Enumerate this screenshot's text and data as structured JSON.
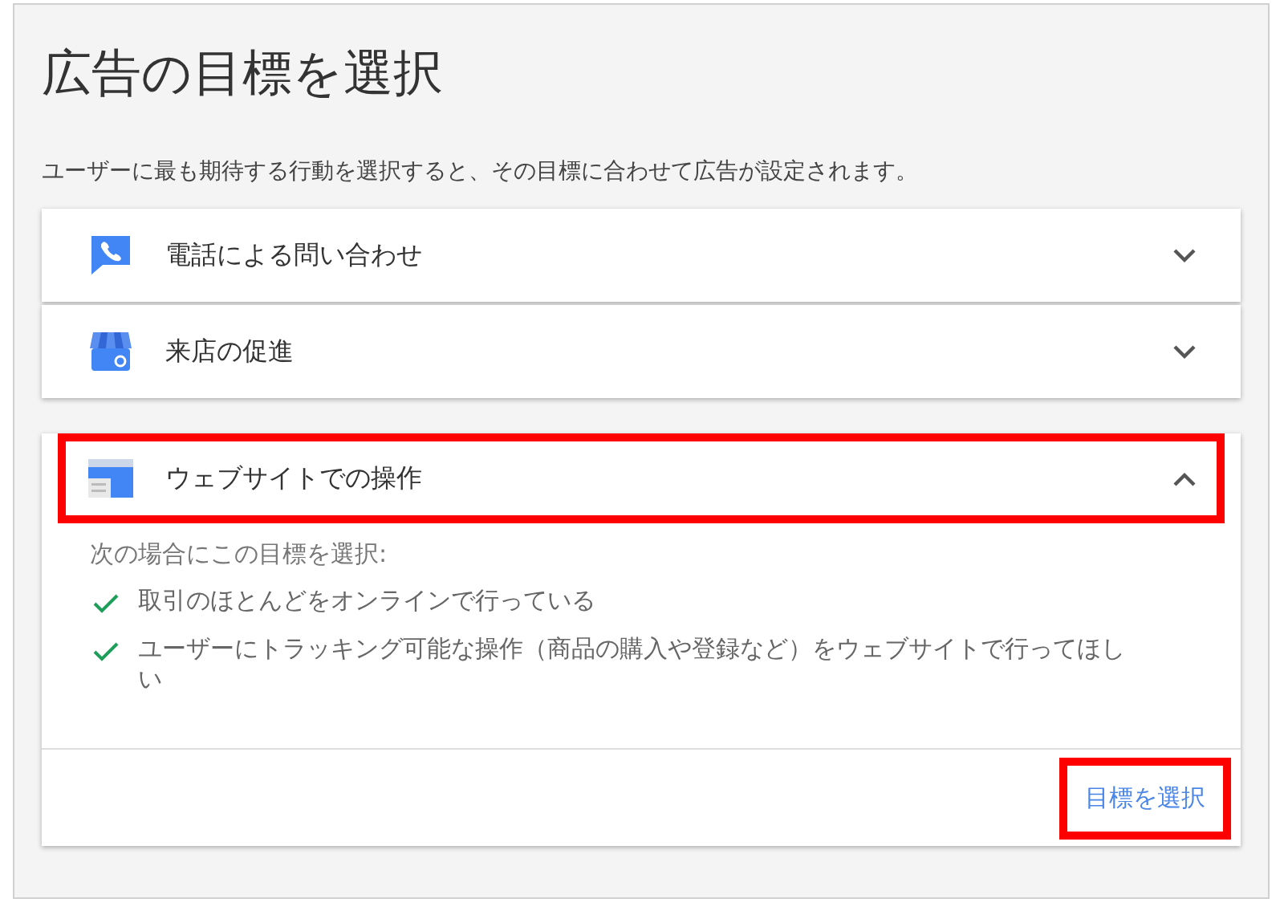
{
  "title": "広告の目標を選択",
  "description": "ユーザーに最も期待する行動を選択すると、その目標に合わせて広告が設定されます。",
  "goals": [
    {
      "kind": "phone",
      "label": "電話による問い合わせ",
      "expanded": false,
      "highlighted": false
    },
    {
      "kind": "store",
      "label": "来店の促進",
      "expanded": false,
      "highlighted": false
    },
    {
      "kind": "website",
      "label": "ウェブサイトでの操作",
      "expanded": true,
      "highlighted": true,
      "intro": "次の場合にこの目標を選択:",
      "reasons": [
        "取引のほとんどをオンラインで行っている",
        "ユーザーにトラッキング可能な操作（商品の購入や登録など）をウェブサイトで行ってほしい"
      ],
      "action": {
        "label": "目標を選択",
        "highlighted": true
      }
    }
  ]
}
